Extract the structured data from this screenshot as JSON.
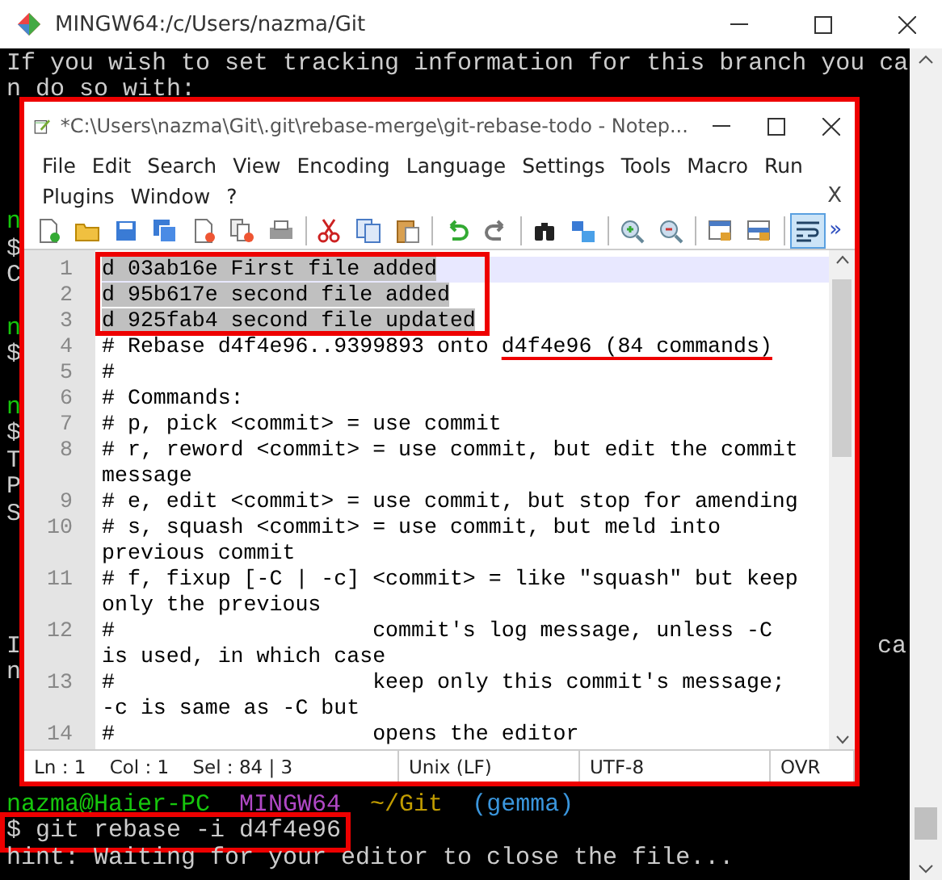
{
  "terminal": {
    "title": "MINGW64:/c/Users/nazma/Git",
    "lines": [
      {
        "segments": [
          {
            "text": "If you wish to set tracking information for this branch you ca",
            "color": "#cccccc"
          }
        ]
      },
      {
        "segments": [
          {
            "text": "n do so with:",
            "color": "#cccccc"
          }
        ]
      },
      {
        "blank": true
      },
      {
        "blank": true
      },
      {
        "blank": true
      },
      {
        "blank": true
      },
      {
        "segments": [
          {
            "text": "n",
            "color": "#16c60c"
          }
        ]
      },
      {
        "segments": [
          {
            "text": "$",
            "color": "#cccccc"
          }
        ]
      },
      {
        "segments": [
          {
            "text": "C",
            "color": "#cccccc"
          }
        ]
      },
      {
        "blank": true
      },
      {
        "segments": [
          {
            "text": "n",
            "color": "#16c60c"
          }
        ]
      },
      {
        "segments": [
          {
            "text": "$",
            "color": "#cccccc"
          }
        ]
      },
      {
        "blank": true
      },
      {
        "segments": [
          {
            "text": "n",
            "color": "#16c60c"
          }
        ]
      },
      {
        "segments": [
          {
            "text": "$",
            "color": "#cccccc"
          }
        ]
      },
      {
        "segments": [
          {
            "text": "T",
            "color": "#cccccc"
          }
        ]
      },
      {
        "segments": [
          {
            "text": "P",
            "color": "#cccccc"
          }
        ]
      },
      {
        "segments": [
          {
            "text": "S",
            "color": "#cccccc"
          }
        ]
      },
      {
        "blank": true
      },
      {
        "blank": true
      },
      {
        "blank": true
      },
      {
        "blank": true
      },
      {
        "segments": [
          {
            "text": "I",
            "color": "#cccccc"
          }
        ],
        "right": "ca"
      },
      {
        "segments": [
          {
            "text": "n",
            "color": "#cccccc"
          }
        ]
      },
      {
        "blank": true
      },
      {
        "blank": true
      },
      {
        "blank": true
      },
      {
        "blank": true
      },
      {
        "segments": [
          {
            "text": "nazma@Haier-PC",
            "color": "#16c60c"
          },
          {
            "text": "MINGW64",
            "color": "#b148c6"
          },
          {
            "text": "~/Git",
            "color": "#c19c00"
          },
          {
            "text": "(gemma)",
            "color": "#3a96dd"
          }
        ]
      },
      {
        "segments": [
          {
            "text": "$ git rebase -i d4f4e96",
            "color": "#cccccc"
          }
        ],
        "boxed": true
      },
      {
        "segments": [
          {
            "text": "hint: Waiting for your editor to close the file...",
            "color": "#cccccc"
          }
        ]
      }
    ]
  },
  "editor": {
    "title": "*C:\\Users\\nazma\\Git\\.git\\rebase-merge\\git-rebase-todo - Notep...",
    "menu_rows": [
      [
        "File",
        "Edit",
        "Search",
        "View",
        "Encoding",
        "Language",
        "Settings",
        "Tools",
        "Macro",
        "Run"
      ],
      [
        "Plugins",
        "Window",
        "?"
      ]
    ],
    "close_document": "X",
    "toolbar": {
      "word_wrap": true,
      "overflow": "»"
    },
    "lines": [
      {
        "number": "1",
        "text": "d 03ab16e First file added",
        "selected": true,
        "current": true,
        "boxed": true
      },
      {
        "number": "2",
        "text": "d 95b617e second file added",
        "selected": true,
        "current": false,
        "boxed": true
      },
      {
        "number": "3",
        "text": "d 925fab4 second file updated",
        "selected": true,
        "current": false,
        "boxed": true
      },
      {
        "number": "4",
        "segments": [
          {
            "text": "# Rebase d4f4e96..9399893 onto "
          },
          {
            "text": "d4f4e96 (84 commands)",
            "underlined": true
          }
        ],
        "selected": false,
        "current": false
      },
      {
        "number": "5",
        "text": "#",
        "selected": false,
        "current": false
      },
      {
        "number": "6",
        "text": "# Commands:",
        "selected": false,
        "current": false
      },
      {
        "number": "7",
        "text": "# p, pick <commit> = use commit",
        "selected": false,
        "current": false
      },
      {
        "number": "8",
        "text": "# r, reword <commit> = use commit, but edit the commit message",
        "selected": false,
        "current": false
      },
      {
        "number": "9",
        "text": "# e, edit <commit> = use commit, but stop for amending",
        "selected": false,
        "current": false
      },
      {
        "number": "10",
        "text": "# s, squash <commit> = use commit, but meld into previous commit",
        "selected": false,
        "current": false
      },
      {
        "number": "11",
        "text": "# f, fixup [-C | -c] <commit> = like \"squash\" but keep only the previous",
        "selected": false,
        "current": false
      },
      {
        "number": "12",
        "text": "#                    commit's log message, unless -C is used, in which case",
        "selected": false,
        "current": false
      },
      {
        "number": "13",
        "text": "#                    keep only this commit's message; -c is same as -C but",
        "selected": false,
        "current": false
      },
      {
        "number": "14",
        "text": "#                    opens the editor",
        "selected": false,
        "current": false
      }
    ],
    "status": [
      "Ln : 1    Col : 1    Sel : 84 | 3",
      "Unix (LF)",
      "UTF-8",
      "OVR"
    ]
  }
}
